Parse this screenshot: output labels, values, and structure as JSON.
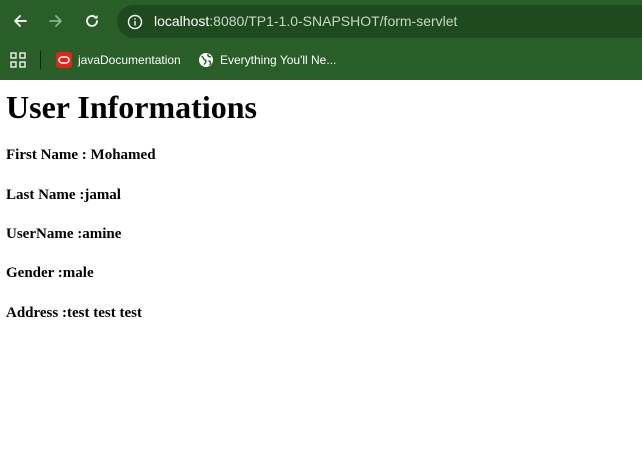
{
  "browser": {
    "url_host": "localhost",
    "url_rest": ":8080/TP1-1.0-SNAPSHOT/form-servlet",
    "chrome_color": "#295e29",
    "bookmarks": [
      {
        "label": "javaDocumentation",
        "icon": "oracle-icon"
      },
      {
        "label": "Everything You'll Ne...",
        "icon": "globe-icon"
      }
    ]
  },
  "page": {
    "title": "User Informations",
    "fields": [
      "First Name : Mohamed",
      "Last Name :jamal",
      "UserName :amine",
      "Gender :male",
      "Address :test test test"
    ]
  }
}
